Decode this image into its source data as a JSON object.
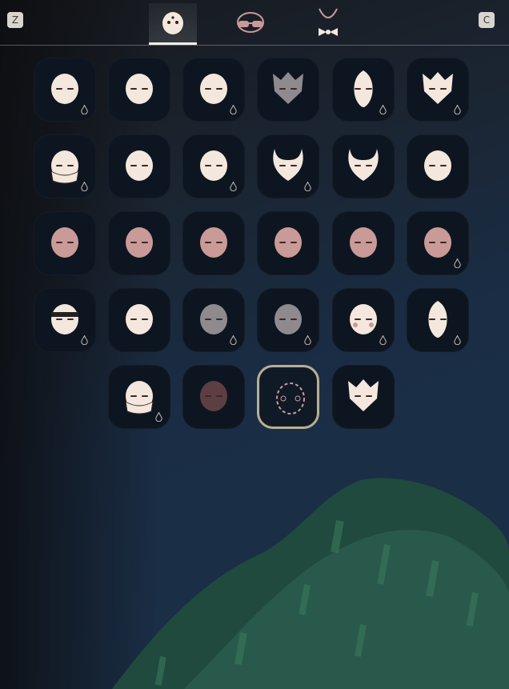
{
  "tabs": {
    "left_key": "Z",
    "right_key": "C",
    "items": [
      {
        "icon": "mask-category-icon",
        "active": true
      },
      {
        "icon": "glasses-category-icon",
        "active": false
      },
      {
        "icon": "necklace-bowtie-category-icon",
        "active": false
      }
    ]
  },
  "colors": {
    "accent": "#f4e7dd",
    "mask_pink": "#c99a97",
    "mask_grey": "#8e8a8e",
    "selected_border": "#b8ae93",
    "slot_bg": "#0d1620"
  },
  "rows": [
    [
      "mask-dots-icon",
      "mask-sparkle-icon",
      "mask-bandana-icon",
      "mask-crown-icon",
      "mask-tall-icon",
      "mask-cat-icon"
    ],
    [
      "mask-scarf-icon",
      "mask-simple-icon",
      "mask-braids-icon",
      "mask-horned-icon",
      "mask-owl-icon",
      "mask-hood-icon"
    ],
    [
      "mask-pink-fold-icon",
      "mask-pink-stripe-icon",
      "mask-pink-paint-icon",
      "mask-pink-scar-icon",
      "mask-pink-plain-icon",
      "mask-pink-gem-icon"
    ],
    [
      "mask-headband-icon",
      "mask-painted-icon",
      "mask-bird-grey-icon",
      "mask-bird-dark-icon",
      "mask-blush-icon",
      "mask-ears-icon"
    ],
    [
      "mask-smoke-icon",
      "mask-round-dark-icon",
      "mask-dashed-icon",
      "mask-fox-icon"
    ]
  ]
}
